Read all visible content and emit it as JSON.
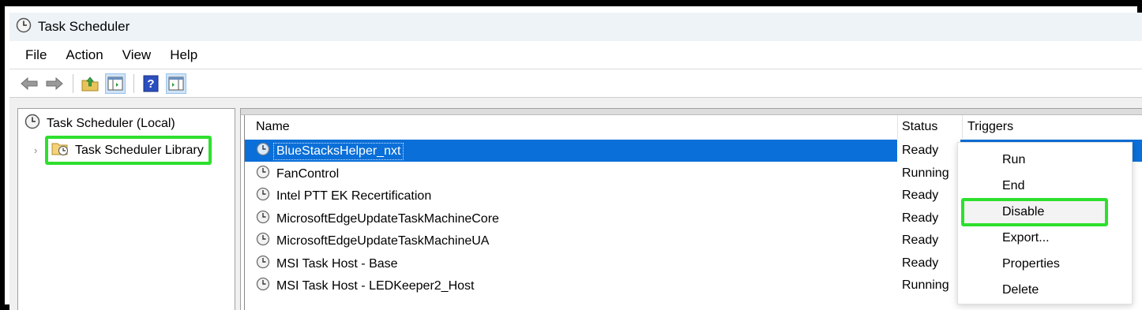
{
  "window": {
    "title": "Task Scheduler"
  },
  "menubar": {
    "items": [
      "File",
      "Action",
      "View",
      "Help"
    ]
  },
  "toolbar": {
    "icons": [
      "back-arrow-icon",
      "forward-arrow-icon",
      "up-folder-icon",
      "show-hide-console-tree-icon",
      "help-icon",
      "show-hide-action-pane-icon"
    ]
  },
  "tree": {
    "root": "Task Scheduler (Local)",
    "child": "Task Scheduler Library"
  },
  "list": {
    "columns": [
      "Name",
      "Status",
      "Triggers"
    ],
    "rows": [
      {
        "name": "BlueStacksHelper_nxt",
        "status": "Ready",
        "selected": true
      },
      {
        "name": "FanControl",
        "status": "Running"
      },
      {
        "name": "Intel PTT EK Recertification",
        "status": "Ready"
      },
      {
        "name": "MicrosoftEdgeUpdateTaskMachineCore",
        "status": "Ready"
      },
      {
        "name": "MicrosoftEdgeUpdateTaskMachineUA",
        "status": "Ready"
      },
      {
        "name": "MSI Task Host - Base",
        "status": "Ready"
      },
      {
        "name": "MSI Task Host - LEDKeeper2_Host",
        "status": "Running"
      }
    ]
  },
  "context_menu": {
    "items": [
      "Run",
      "End",
      "Disable",
      "Export...",
      "Properties",
      "Delete"
    ],
    "highlighted": "Disable"
  },
  "colors": {
    "selection": "#0a6fd8",
    "highlight_box": "#2ee02e"
  }
}
